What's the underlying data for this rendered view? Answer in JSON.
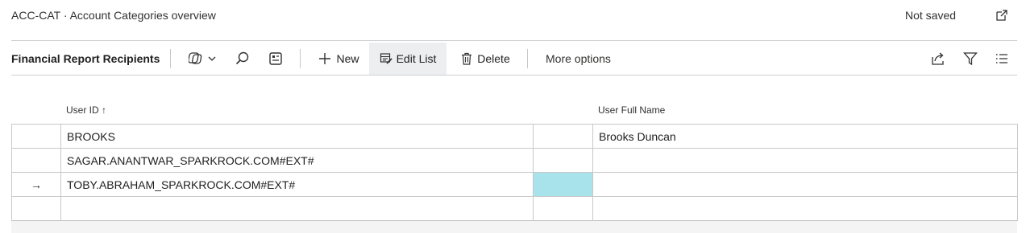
{
  "header": {
    "title": "ACC-CAT · Account Categories overview",
    "status": "Not saved"
  },
  "toolbar": {
    "title": "Financial Report Recipients",
    "new_label": "New",
    "edit_list_label": "Edit List",
    "delete_label": "Delete",
    "more_options_label": "More options"
  },
  "table": {
    "columns": [
      {
        "label": "User ID ↑"
      },
      {
        "label": "User Full Name"
      }
    ],
    "rows": [
      {
        "marker": "",
        "user_id": "BROOKS",
        "user_full_name": "Brooks Duncan"
      },
      {
        "marker": "",
        "user_id": "SAGAR.ANANTWAR_SPARKROCK.COM#EXT#",
        "user_full_name": ""
      },
      {
        "marker": "→",
        "user_id": "TOBY.ABRAHAM_SPARKROCK.COM#EXT#",
        "user_full_name": ""
      },
      {
        "marker": "",
        "user_id": "",
        "user_full_name": ""
      }
    ],
    "selected_row": 2
  },
  "colors": {
    "selected_cell": "#a8e2ea",
    "active_button": "#eceef0"
  },
  "icons": {
    "popout": "open-in-new-window-icon",
    "views": "office-views-icon",
    "search": "search-icon",
    "layout": "personalize-icon",
    "new": "plus-icon",
    "edit_list": "edit-list-icon",
    "delete": "trash-icon",
    "share": "share-icon",
    "filter": "filter-icon",
    "list_view": "list-view-icon"
  }
}
